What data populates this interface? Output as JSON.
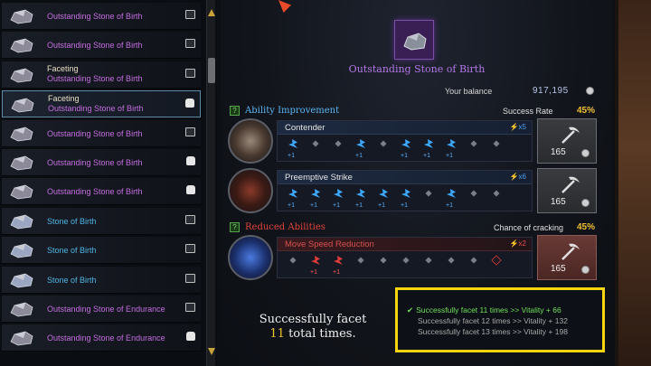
{
  "list": {
    "items": [
      {
        "line1": "",
        "line2": "Outstanding Stone of Birth",
        "color": "purple",
        "badge": "card"
      },
      {
        "line1": "",
        "line2": "Outstanding Stone of Birth",
        "color": "purple",
        "badge": "card"
      },
      {
        "line1": "Faceting",
        "line2": "Outstanding Stone of Birth",
        "color": "purple",
        "badge": "card"
      },
      {
        "line1": "Faceting",
        "line2": "Outstanding Stone of Birth",
        "color": "purple",
        "badge": "bag",
        "selected": true
      },
      {
        "line1": "",
        "line2": "Outstanding Stone of Birth",
        "color": "purple",
        "badge": "card"
      },
      {
        "line1": "",
        "line2": "Outstanding Stone of Birth",
        "color": "purple",
        "badge": "bag"
      },
      {
        "line1": "",
        "line2": "Outstanding Stone of Birth",
        "color": "purple",
        "badge": "bag"
      },
      {
        "line1": "",
        "line2": "Stone of Birth",
        "color": "blue",
        "badge": "card"
      },
      {
        "line1": "",
        "line2": "Stone of Birth",
        "color": "blue",
        "badge": "card"
      },
      {
        "line1": "",
        "line2": "Stone of Birth",
        "color": "blue",
        "badge": "card"
      },
      {
        "line1": "",
        "line2": "Outstanding Stone of Endurance",
        "color": "purple",
        "badge": "card"
      },
      {
        "line1": "",
        "line2": "Outstanding Stone of Endurance",
        "color": "purple",
        "badge": "bag"
      }
    ]
  },
  "stone": {
    "title": "Outstanding Stone of Birth",
    "balance_label": "Your balance",
    "balance_value": "917,195"
  },
  "improvement": {
    "heading": "Ability Improvement",
    "rate_label": "Success Rate",
    "rate_value": "45%",
    "rows": [
      {
        "name": "Contender",
        "mult": "x5",
        "cost": "165"
      },
      {
        "name": "Preemptive Strike",
        "mult": "x6",
        "cost": "165"
      }
    ]
  },
  "reduced": {
    "heading": "Reduced Abilities",
    "rate_label": "Chance of cracking",
    "rate_value": "45%",
    "row": {
      "name": "Move Speed Reduction",
      "mult": "x2",
      "cost": "165"
    }
  },
  "plus_label": "+1",
  "total": {
    "line1": "Successfully facet",
    "count": "11",
    "line2_suffix": "total times."
  },
  "results": [
    {
      "text": "Successfully facet 11 times >> Vitality + 66",
      "achieved": true
    },
    {
      "text": "Successfully facet 12 times >> Vitality + 132",
      "achieved": false
    },
    {
      "text": "Successfully facet 13 times >> Vitality + 198",
      "achieved": false
    }
  ],
  "colors": {
    "accent_gold": "#f0c030",
    "improve_blue": "#3da8ff",
    "reduce_red": "#e03a3a",
    "highlight_box": "#f5d60e"
  }
}
